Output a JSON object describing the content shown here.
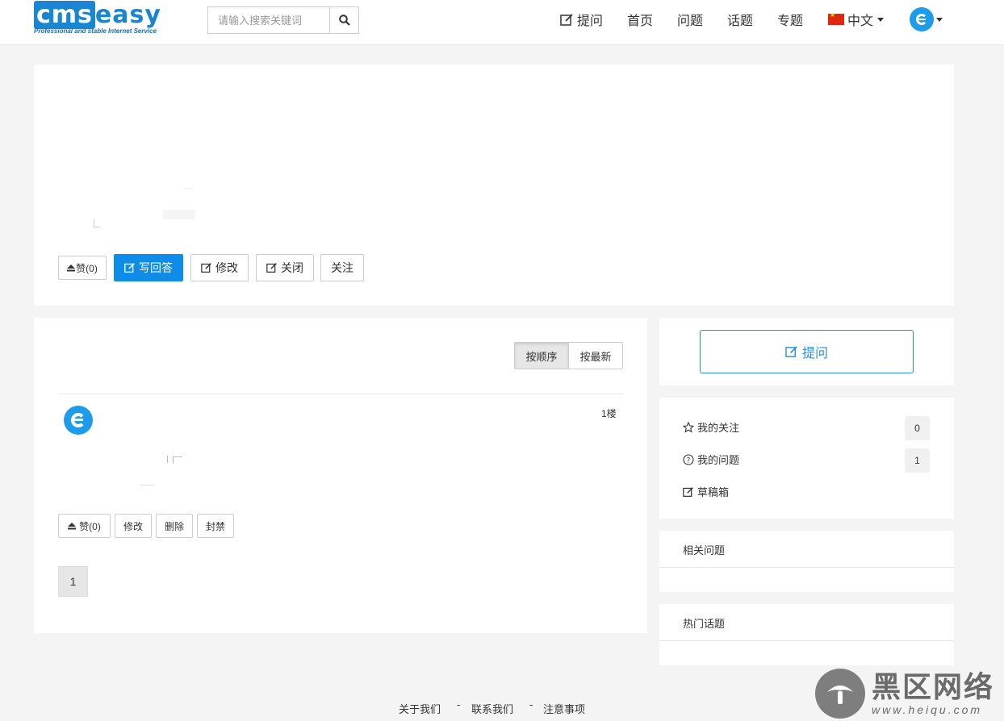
{
  "header": {
    "logo_brand_cms": "cms",
    "logo_brand_easy": "easy",
    "logo_tagline": "Professional and stable Internet Service",
    "search_placeholder": "请输入搜索关键词",
    "nav": {
      "ask": "提问",
      "home": "首页",
      "questions": "问题",
      "topics": "话题",
      "specials": "专题",
      "language": "中文"
    }
  },
  "question": {
    "like_label": "赞(0)",
    "write_answer_label": "写回答",
    "edit_label": "修改",
    "close_label": "关闭",
    "follow_label": "关注"
  },
  "answers": {
    "sort_order_label": "按顺序",
    "sort_newest_label": "按最新",
    "items": [
      {
        "floor": "1楼",
        "like_label": "赞(0)",
        "edit_label": "修改",
        "delete_label": "删除",
        "ban_label": "封禁"
      }
    ],
    "pagination_current": "1"
  },
  "sidebar": {
    "ask_button_label": "提问",
    "my_follows_label": "我的关注",
    "my_follows_count": "0",
    "my_questions_label": "我的问题",
    "my_questions_count": "1",
    "drafts_label": "草稿箱",
    "related_questions_title": "相关问题",
    "hot_topics_title": "热门话题"
  },
  "footer": {
    "about": "关于我们",
    "contact": "联系我们",
    "notes": "注意事项",
    "separator": "-"
  },
  "watermark": {
    "text": "黑区网络",
    "url": "www.heiqu.com"
  },
  "colors": {
    "primary": "#0d8ce8",
    "avatar": "#1e9be9",
    "background": "#f4f4f4"
  }
}
